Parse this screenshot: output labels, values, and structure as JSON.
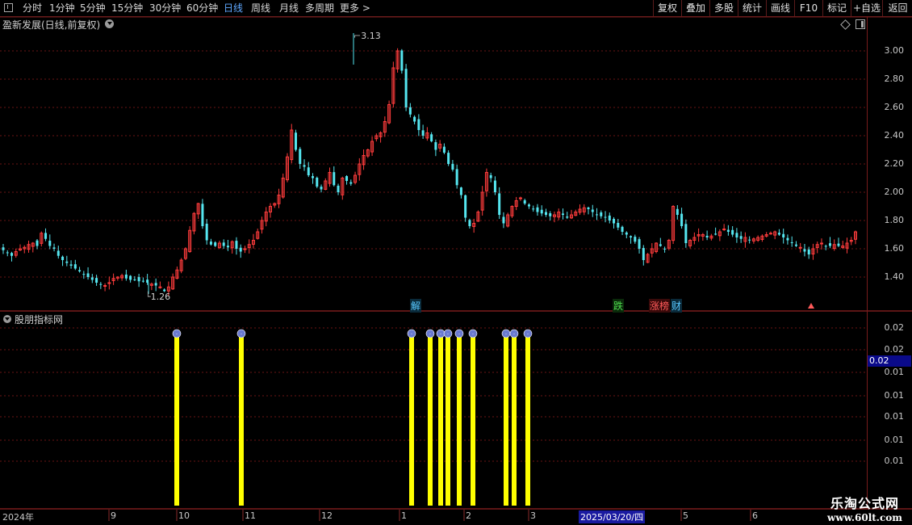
{
  "toolbar": {
    "periods": [
      "分时",
      "1分钟",
      "5分钟",
      "15分钟",
      "30分钟",
      "60分钟",
      "日线",
      "周线",
      "月线",
      "多周期",
      "更多 >"
    ],
    "actions": [
      "复权",
      "叠加",
      "多股",
      "统计",
      "画线",
      "F10",
      "标记",
      "+自选",
      "返回"
    ]
  },
  "main_pane": {
    "title": "盈新发展(日线,前复权)",
    "y_ticks": [
      "3.00",
      "2.80",
      "2.60",
      "2.40",
      "2.20",
      "2.00",
      "1.80",
      "1.60",
      "1.40"
    ],
    "high_label": "3.13",
    "low_label": "1.26",
    "markers": [
      {
        "text": "解",
        "color": "#58c8ff"
      },
      {
        "text": "跌",
        "color": "#4fdc4f"
      },
      {
        "text": "涨榜",
        "color": "#ff5a5a"
      },
      {
        "text": "财",
        "color": "#58c8ff"
      }
    ]
  },
  "indicator_pane": {
    "title": "股朋指标网",
    "y_ticks": [
      "0.02",
      "0.02",
      "0.01",
      "0.01",
      "0.01",
      "0.01",
      "0.01"
    ],
    "current_value": "0.02"
  },
  "date_axis": {
    "labels": [
      "2024年",
      "9",
      "10",
      "11",
      "12",
      "1",
      "2",
      "3",
      "2025/03/20/四",
      "5",
      "6"
    ]
  },
  "watermark": {
    "title": "乐淘公式网",
    "url": "www.60lt.com"
  },
  "colors": {
    "up": "#ff3c3c",
    "down": "#55e6f0",
    "signal": "#ffff00",
    "grid": "#6a1515",
    "border": "#7a1c1c"
  },
  "chart_data": {
    "type": "candlestick",
    "series": [
      {
        "name": "price_close",
        "values": [
          1.59,
          1.57,
          1.55,
          1.58,
          1.6,
          1.61,
          1.63,
          1.64,
          1.62,
          1.71,
          1.67,
          1.62,
          1.6,
          1.55,
          1.52,
          1.5,
          1.48,
          1.46,
          1.44,
          1.42,
          1.4,
          1.38,
          1.36,
          1.35,
          1.34,
          1.36,
          1.39,
          1.4,
          1.41,
          1.39,
          1.38,
          1.38,
          1.37,
          1.37,
          1.36,
          1.35,
          1.34,
          1.33,
          1.3,
          1.33,
          1.4,
          1.45,
          1.52,
          1.6,
          1.73,
          1.85,
          1.92,
          1.76,
          1.66,
          1.63,
          1.62,
          1.64,
          1.62,
          1.61,
          1.65,
          1.6,
          1.58,
          1.6,
          1.63,
          1.66,
          1.72,
          1.8,
          1.86,
          1.9,
          1.92,
          1.98,
          2.1,
          2.25,
          2.44,
          2.3,
          2.2,
          2.18,
          2.12,
          2.1,
          2.04,
          2.02,
          2.08,
          2.14,
          2.05,
          2.0,
          2.1,
          2.08,
          2.06,
          2.12,
          2.2,
          2.26,
          2.3,
          2.36,
          2.4,
          2.42,
          2.5,
          2.62,
          2.88,
          3.0,
          2.86,
          2.6,
          2.55,
          2.5,
          2.44,
          2.4,
          2.42,
          2.36,
          2.3,
          2.34,
          2.28,
          2.2,
          2.16,
          2.05,
          1.98,
          1.82,
          1.76,
          1.78,
          1.86,
          2.0,
          2.14,
          2.1,
          2.0,
          1.84,
          1.78,
          1.84,
          1.9,
          1.94,
          1.96,
          1.92,
          1.9,
          1.88,
          1.86,
          1.85,
          1.84,
          1.83,
          1.84,
          1.86,
          1.84,
          1.82,
          1.84,
          1.86,
          1.88,
          1.89,
          1.88,
          1.86,
          1.84,
          1.83,
          1.82,
          1.8,
          1.78,
          1.75,
          1.72,
          1.7,
          1.68,
          1.65,
          1.6,
          1.52,
          1.56,
          1.6,
          1.64,
          1.62,
          1.6,
          1.66,
          1.9,
          1.84,
          1.76,
          1.64,
          1.66,
          1.68,
          1.7,
          1.7,
          1.68,
          1.69,
          1.7,
          1.72,
          1.74,
          1.72,
          1.7,
          1.68,
          1.67,
          1.68,
          1.66,
          1.67,
          1.68,
          1.69,
          1.7,
          1.71,
          1.72,
          1.7,
          1.68,
          1.66,
          1.64,
          1.62,
          1.61,
          1.58,
          1.56,
          1.6,
          1.63,
          1.64,
          1.62,
          1.62,
          1.63,
          1.62,
          1.62,
          1.64,
          1.66,
          1.72
        ]
      },
      {
        "name": "signal",
        "values": [
          0.02,
          0.02,
          0.02,
          0.02,
          0.02,
          0.02,
          0.02,
          0.02,
          0.02,
          0.02,
          0.02,
          0.02
        ]
      }
    ],
    "ylim": [
      1.26,
      3.13
    ]
  }
}
